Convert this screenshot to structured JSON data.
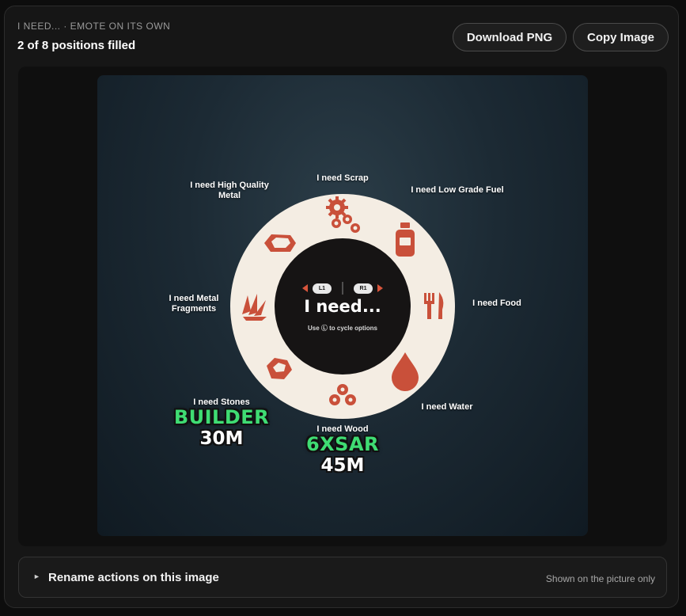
{
  "header": {
    "eyebrow": "I NEED... · EMOTE ON ITS OWN",
    "status": "2 of 8 positions filled"
  },
  "toolbar": {
    "download_label": "Download PNG",
    "copy_label": "Copy Image"
  },
  "wheel": {
    "center_title": "I need...",
    "center_hint": "Use Ⓛ to cycle options",
    "left_bumper": "L1",
    "right_bumper": "R1",
    "options": [
      {
        "label": "I need Scrap",
        "icon": "gears-icon"
      },
      {
        "label": "I need Low Grade Fuel",
        "icon": "fuel-can-icon"
      },
      {
        "label": "I need Food",
        "icon": "cutlery-icon"
      },
      {
        "label": "I need Water",
        "icon": "water-drop-icon"
      },
      {
        "label": "I need Wood",
        "icon": "logs-icon"
      },
      {
        "label": "I need Stones",
        "icon": "stone-icon"
      },
      {
        "label": "I need Metal Fragments",
        "icon": "metal-fragments-icon"
      },
      {
        "label": "I need High Quality Metal",
        "icon": "hq-metal-icon"
      }
    ],
    "claims": [
      {
        "slot": "I need Stones",
        "name": "BUILDER",
        "value": "30M"
      },
      {
        "slot": "I need Wood",
        "name": "6XSAR",
        "value": "45M"
      }
    ],
    "colors": {
      "ring": "#f4ede3",
      "hub": "#161414",
      "icon": "#c9503a",
      "claim_name": "#3fdc73"
    }
  },
  "rename": {
    "label": "Rename actions on this image",
    "note": "Shown on the picture only"
  }
}
